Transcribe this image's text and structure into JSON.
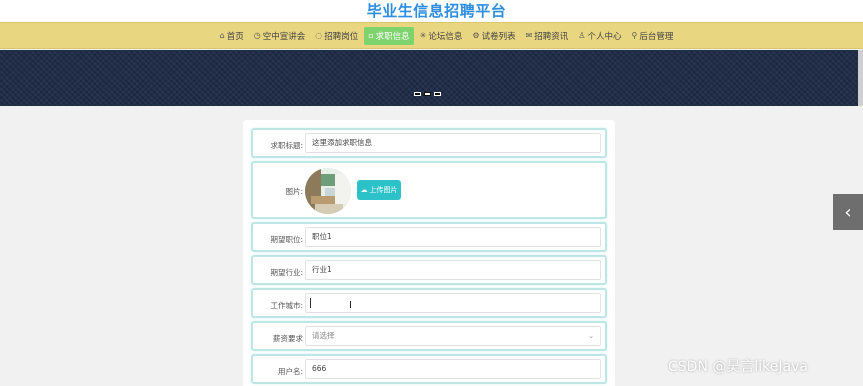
{
  "site": {
    "title": "毕业生信息招聘平台"
  },
  "nav": {
    "items": [
      {
        "icon": "home-icon",
        "glyph": "⌂",
        "label": "首页"
      },
      {
        "icon": "clock-icon",
        "glyph": "◷",
        "label": "空中宣讲会"
      },
      {
        "icon": "compass-icon",
        "glyph": "◌",
        "label": "招聘岗位"
      },
      {
        "icon": "grid-icon",
        "glyph": "▫",
        "label": "求职信息"
      },
      {
        "icon": "asterisk-icon",
        "glyph": "✳",
        "label": "论坛信息"
      },
      {
        "icon": "settings-icon",
        "glyph": "⚙",
        "label": "试卷列表"
      },
      {
        "icon": "news-icon",
        "glyph": "✉",
        "label": "招聘资讯"
      },
      {
        "icon": "user-icon",
        "glyph": "♙",
        "label": "个人中心"
      },
      {
        "icon": "link-icon",
        "glyph": "⚲",
        "label": "后台管理"
      }
    ],
    "active_index": 3
  },
  "banner": {
    "slide_count": 3,
    "active_slide": 1
  },
  "form": {
    "title": {
      "label": "求职标题:",
      "value": "这里添加求职信息"
    },
    "image": {
      "label": "图片:",
      "upload_label": "上传图片"
    },
    "position": {
      "label": "期望职位:",
      "value": "职位1"
    },
    "industry": {
      "label": "期望行业:",
      "value": "行业1"
    },
    "city": {
      "label": "工作城市:",
      "value": ""
    },
    "salary": {
      "label": "薪资要求",
      "value": "请选择"
    },
    "username": {
      "label": "用户名:",
      "value": "666"
    }
  },
  "watermark": {
    "text": "CSDN @昊言likeJava"
  },
  "colors": {
    "nav_bg": "#e9d680",
    "nav_active": "#7ed36d",
    "title_blue": "#2e8ee0",
    "banner_navy": "#1d2a46",
    "upload_button": "#2cc2c8",
    "field_border": "#bfe6e6"
  }
}
